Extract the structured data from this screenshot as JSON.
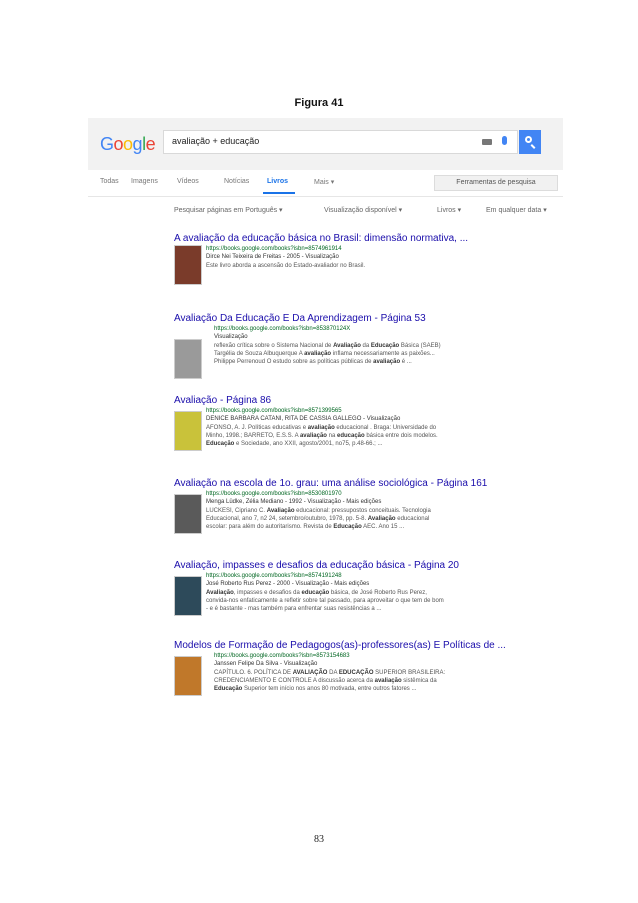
{
  "figure_title": "Figura 41",
  "logo": "Google",
  "search": {
    "query": "avaliação + educação"
  },
  "tabs": [
    "Todas",
    "Imagens",
    "Vídeos",
    "Notícias",
    "Livros",
    "Mais ▾"
  ],
  "active_tab": "Livros",
  "tools_button": "Ferramentas de pesquisa",
  "filters": [
    "Pesquisar páginas em Português ▾",
    "Visualização disponível ▾",
    "Livros ▾",
    "Em qualquer data ▾"
  ],
  "results": [
    {
      "title": "A avaliação da educação básica no Brasil: dimensão normativa, ...",
      "url": "https://books.google.com/books?isbn=8574961914",
      "meta": "Dirce Nei Teixeira de Freitas - 2005 - Visualização",
      "snippet": [
        "Este livro aborda a ascensão do Estado-avaliador no Brasil."
      ],
      "thumb_color": "#7a3b2a"
    },
    {
      "title": "Avaliação Da Educação E Da Aprendizagem - Página 53",
      "url": "https://books.google.com/books?isbn=853870124X",
      "meta": "Visualização",
      "snippet": [
        "reflexão crítica sobre o Sistema Nacional de <b>Avaliação</b> da <b>Educação</b> Básica (SAEB)",
        "Targélia de Souza Albuquerque A <b>avaliação</b> inflama necessariamente as paixões...",
        "Philippe Perrenoud O estudo sobre as políticas públicas de <b>avaliação</b> é ..."
      ],
      "thumb_color": "#9a9a9a"
    },
    {
      "title": "Avaliação - Página 86",
      "url": "https://books.google.com/books?isbn=8571399565",
      "meta": "DENICE BARBARA CATANI, RITA DE CASSIA GALLEGO - Visualização",
      "snippet": [
        "AFONSO, A. J. Políticas educativas e <b>avaliação</b> educacional . Braga: Universidade do",
        "Minho, 1998.; BARRETO, E.S.S. A <b>avaliação</b> na <b>educação</b> básica entre dois modelos.",
        "<b>Educação</b> e Sociedade, ano XXII, agosto/2001, no75, p.48-66.; ..."
      ],
      "thumb_color": "#c9c23a"
    },
    {
      "title": "Avaliação na escola de 1o. grau: uma análise sociológica - Página 161",
      "url": "https://books.google.com/books?isbn=8530801970",
      "meta": "Menga Lüdke, Zélia Mediano - 1992 - Visualização - Mais edições",
      "snippet": [
        "LUCKESI, Cipriano C. <b>Avaliação</b> educacional: pressupostos conceituais. Tecnologia",
        "Educacional, ano 7, n2 24, setembro/outubro, 1978, pp. 5-8. <b>Avaliação</b> educacional",
        "escolar: para além do autoritarismo. Revista de <b>Educação</b> AEC. Ano 15 ..."
      ],
      "thumb_color": "#5a5a5a"
    },
    {
      "title": "Avaliação, impasses e desafios da educação básica - Página 20",
      "url": "https://books.google.com/books?isbn=8574191248",
      "meta": "José Roberto Rus Perez - 2000 - Visualização - Mais edições",
      "snippet": [
        "<b>Avaliação</b>, impasses e desafios da <b>educação</b> básica, de José Roberto Rus Perez,",
        "convida-nos enfaticamente a refletir sobre tal passado, para aproveitar o que tem de bom",
        "- e é bastante - mas também para enfrentar suas resistências a ..."
      ],
      "thumb_color": "#2d4a5a"
    },
    {
      "title": "Modelos de Formação de Pedagogos(as)-professores(as) E Políticas de ...",
      "url": "https://books.google.com/books?isbn=8573154683",
      "meta": "Janssen Felipe Da Silva - Visualização",
      "snippet": [
        "CAPÍTULO. 6. POLÍTICA DE <b>AVALIAÇÃO</b> DA <b>EDUCAÇÃO</b> SUPERIOR BRASILEIRA:",
        "CREDENCIAMENTO E CONTROLE A discussão acerca da <b>avaliação</b> sistêmica da",
        "<b>Educação</b> Superior tem início nos anos 80 motivada, entre outros fatores ..."
      ],
      "thumb_color": "#c0782a"
    }
  ],
  "page_number": "83"
}
